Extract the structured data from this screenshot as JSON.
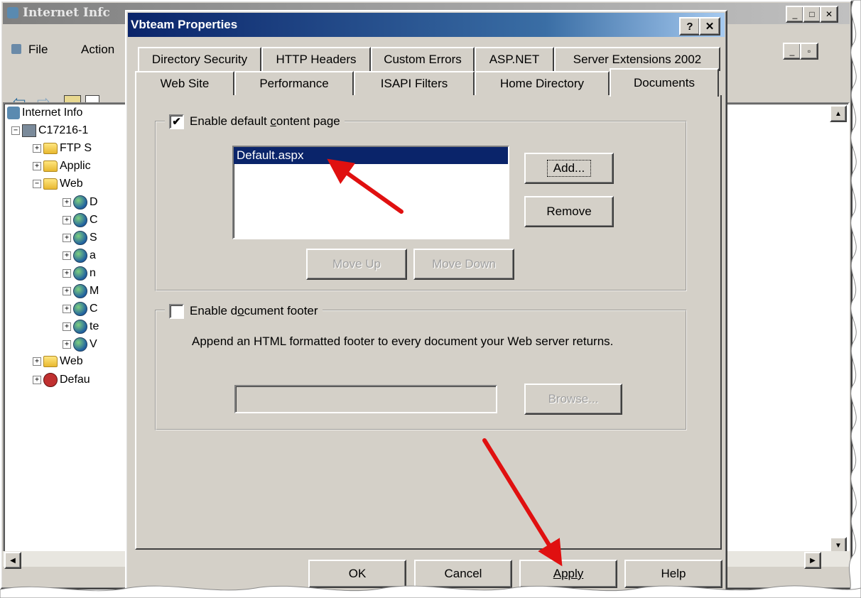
{
  "background_window": {
    "title": "Internet Infc",
    "menu": [
      "File",
      "Action"
    ],
    "tree": [
      {
        "label": "Internet Info",
        "level": 0,
        "icon": "iis-icon"
      },
      {
        "label": "C17216-1",
        "level": 1,
        "icon": "computer-icon"
      },
      {
        "label": "FTP S",
        "level": 2,
        "icon": "folder-icon"
      },
      {
        "label": "Applic",
        "level": 2,
        "icon": "folder-icon"
      },
      {
        "label": "Web",
        "level": 2,
        "icon": "folder-icon"
      },
      {
        "label": "D",
        "level": 3,
        "icon": "globe-icon"
      },
      {
        "label": "C",
        "level": 3,
        "icon": "globe-icon"
      },
      {
        "label": "S",
        "level": 3,
        "icon": "globe-icon"
      },
      {
        "label": "a",
        "level": 3,
        "icon": "globe-icon"
      },
      {
        "label": "n",
        "level": 3,
        "icon": "globe-icon"
      },
      {
        "label": "M",
        "level": 3,
        "icon": "globe-icon"
      },
      {
        "label": "C",
        "level": 3,
        "icon": "globe-icon"
      },
      {
        "label": "te",
        "level": 3,
        "icon": "globe-icon"
      },
      {
        "label": "V",
        "level": 3,
        "icon": "globe-icon"
      },
      {
        "label": "Web",
        "level": 2,
        "icon": "folder-icon"
      },
      {
        "label": "Defau",
        "level": 2,
        "icon": "stopped-site-icon"
      }
    ]
  },
  "dialog": {
    "title": "Vbteam Properties",
    "help_glyph": "?",
    "close_glyph": "✕",
    "tabs_row1": [
      "Directory Security",
      "HTTP Headers",
      "Custom Errors",
      "ASP.NET",
      "Server Extensions 2002"
    ],
    "tabs_row2": [
      "Web Site",
      "Performance",
      "ISAPI Filters",
      "Home Directory",
      "Documents"
    ],
    "active_tab": "Documents",
    "content_group": {
      "checked": true,
      "label_pre": "Enable default ",
      "label_accel": "c",
      "label_post": "ontent page",
      "list_items": [
        "Default.aspx"
      ],
      "add_button": "Add...",
      "remove_button": "Remove",
      "move_up_button": "Move Up",
      "move_down_button": "Move Down"
    },
    "footer_group": {
      "checked": false,
      "label_pre": "Enable d",
      "label_accel": "o",
      "label_post": "cument footer",
      "description": "Append an HTML formatted footer to every document your Web server returns.",
      "path_value": "",
      "browse_button": "Browse..."
    },
    "buttons": {
      "ok": "OK",
      "cancel": "Cancel",
      "apply": "Apply",
      "help": "Help"
    }
  },
  "colors": {
    "title_bar_start": "#0a246a",
    "title_bar_end": "#a6caf0",
    "dialog_face": "#d4d0c8",
    "selection": "#0a246a",
    "annotation_arrow": "#e01010"
  }
}
